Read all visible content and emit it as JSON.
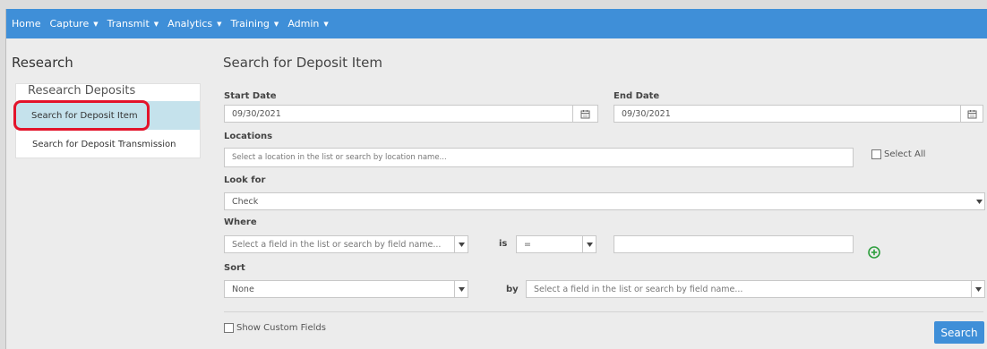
{
  "nav": {
    "items": [
      {
        "label": "Home",
        "caret": false
      },
      {
        "label": "Capture",
        "caret": true
      },
      {
        "label": "Transmit",
        "caret": true
      },
      {
        "label": "Analytics",
        "caret": true
      },
      {
        "label": "Training",
        "caret": true
      },
      {
        "label": "Admin",
        "caret": true
      }
    ],
    "caret_glyph": "▼",
    "bg": "#3f8fd8"
  },
  "sidebar": {
    "title": "Research",
    "section": "Research Deposits",
    "items": [
      {
        "label": "Search for Deposit Item",
        "active": true
      },
      {
        "label": "Search for Deposit Transmission",
        "active": false
      }
    ],
    "highlight_color": "#e3142b"
  },
  "main": {
    "title": "Search for Deposit Item",
    "start_date": {
      "label": "Start Date",
      "value": "09/30/2021"
    },
    "end_date": {
      "label": "End Date",
      "value": "09/30/2021"
    },
    "locations": {
      "label": "Locations",
      "placeholder": "Select a location in the list or search by location name...",
      "select_all": "Select All"
    },
    "look_for": {
      "label": "Look for",
      "value": "Check"
    },
    "where": {
      "label": "Where",
      "field_placeholder": "Select a field in the list or search by field name...",
      "is_label": "is",
      "operator": "=",
      "value": ""
    },
    "sort": {
      "label": "Sort",
      "value": "None",
      "by_label": "by",
      "field_placeholder": "Select a field in the list or search by field name..."
    },
    "show_custom_fields": "Show Custom Fields",
    "search_button": "Search"
  },
  "icons": {
    "calendar": "calendar-icon",
    "dropdown": "caret-down-icon",
    "add": "plus-circle-icon"
  },
  "colors": {
    "accent": "#3f8fd8",
    "add_icon": "#2e9e3e",
    "active_item": "#c5e2ec"
  }
}
